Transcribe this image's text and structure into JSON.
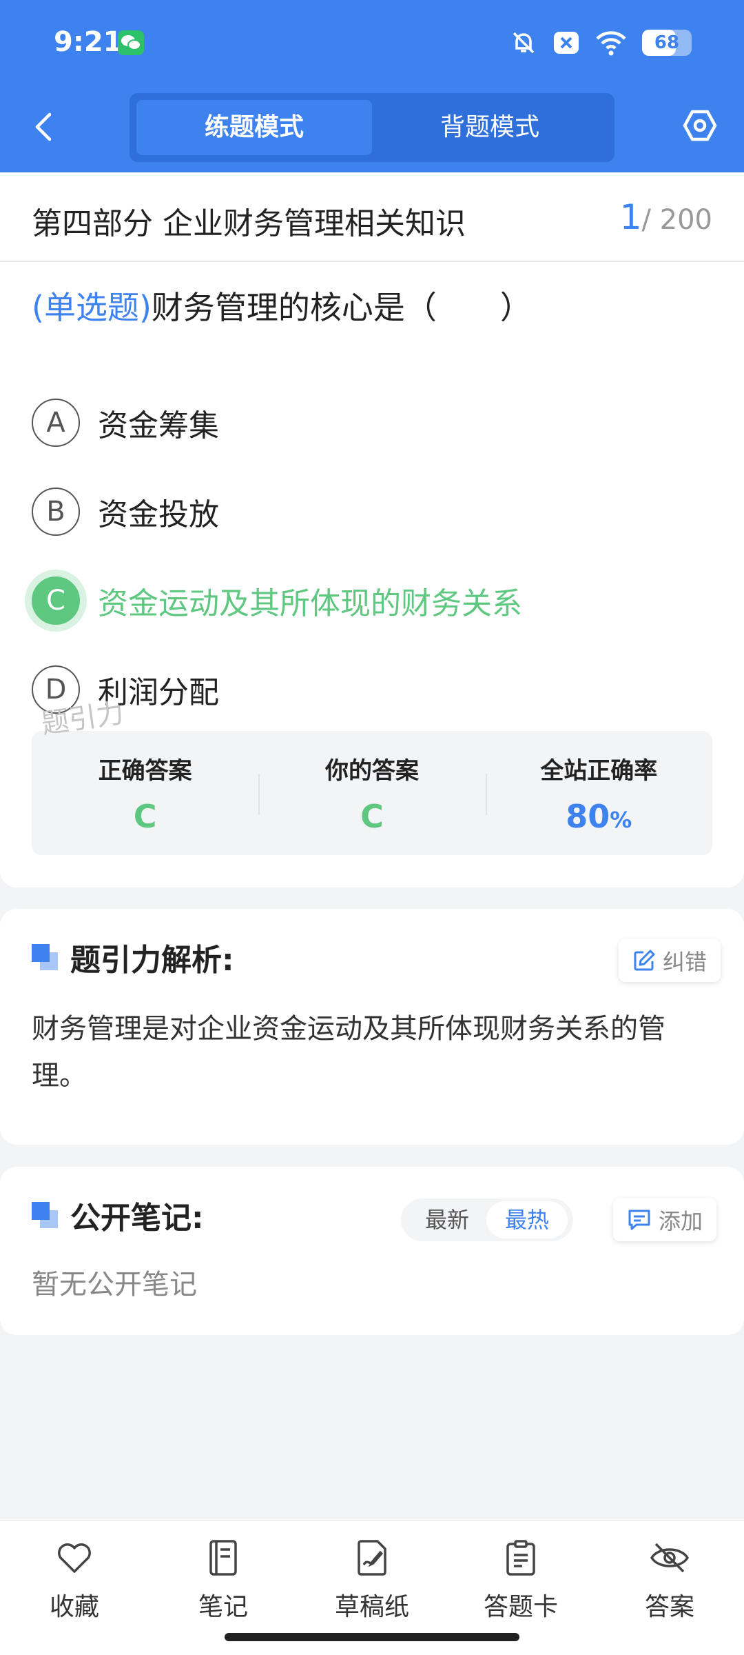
{
  "status_bar": {
    "time": "9:21",
    "battery": "68",
    "battery_level": 0.68
  },
  "header": {
    "tabs": [
      {
        "label": "练题模式",
        "active": true
      },
      {
        "label": "背题模式",
        "active": false
      }
    ]
  },
  "question": {
    "section": "第四部分 企业财务管理相关知识",
    "current": "1",
    "total": "/ 200",
    "type": "(单选题)",
    "text": "财务管理的核心是（　　）",
    "options": [
      {
        "letter": "A",
        "text": "资金筹集",
        "state": "normal"
      },
      {
        "letter": "B",
        "text": "资金投放",
        "state": "normal"
      },
      {
        "letter": "C",
        "text": "资金运动及其所体现的财务关系",
        "state": "correct"
      },
      {
        "letter": "D",
        "text": "利润分配",
        "state": "normal"
      }
    ]
  },
  "stats": {
    "correct_label": "正确答案",
    "correct_value": "C",
    "yours_label": "你的答案",
    "yours_value": "C",
    "rate_label": "全站正确率",
    "rate_value": "80",
    "rate_unit": "%"
  },
  "watermark": "题引力",
  "analysis": {
    "title": "题引力解析:",
    "report_label": "纠错",
    "text": "财务管理是对企业资金运动及其所体现财务关系的管理。"
  },
  "notes": {
    "title": "公开笔记:",
    "sort_options": [
      "最新",
      "最热"
    ],
    "sort_selected": "最热",
    "add_label": "添加",
    "empty_text": "暂无公开笔记"
  },
  "bottom_nav": [
    {
      "label": "收藏",
      "icon": "heart-icon"
    },
    {
      "label": "笔记",
      "icon": "notebook-icon"
    },
    {
      "label": "草稿纸",
      "icon": "draft-paper-icon"
    },
    {
      "label": "答题卡",
      "icon": "answer-sheet-icon"
    },
    {
      "label": "答案",
      "icon": "eye-off-icon"
    }
  ],
  "colors": {
    "primary": "#3d82ee",
    "correct": "#5ec780",
    "background": "#f3f4f6"
  }
}
